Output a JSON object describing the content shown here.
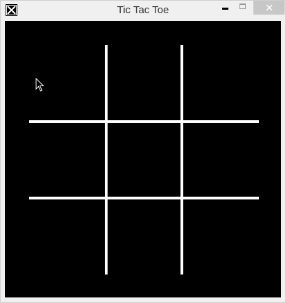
{
  "window": {
    "title": "Tic Tac Toe"
  },
  "titlebar": {
    "icon": "tic-tac-toe-icon",
    "buttons": [
      "minimize-icon",
      "maximize-icon",
      "close-icon"
    ]
  },
  "board": {
    "rows": 3,
    "cols": 3,
    "cells": [
      [
        "",
        "",
        ""
      ],
      [
        "",
        "",
        ""
      ],
      [
        "",
        "",
        ""
      ]
    ]
  },
  "colors": {
    "board_background": "#000000",
    "grid_lines": "#ffffff",
    "chrome": "#f0f0f0",
    "close_button": "#c7c7c7"
  }
}
